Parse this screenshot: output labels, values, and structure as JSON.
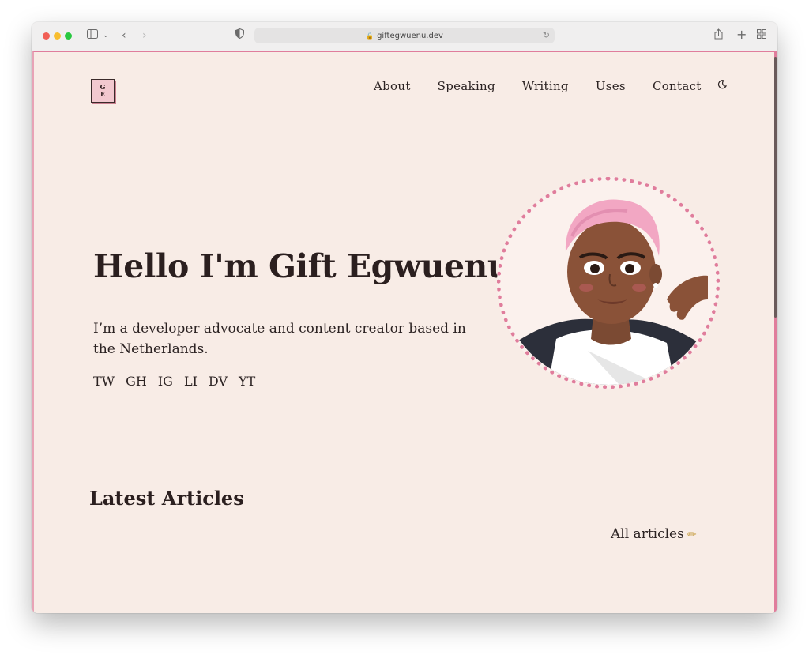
{
  "browser": {
    "url": "giftegwuenu.dev",
    "icons": {
      "sidebar": "sidebar-icon",
      "chevron": "chevron-down-icon",
      "back": "back-icon",
      "forward": "forward-icon",
      "shield": "shield-icon",
      "lock": "lock-icon",
      "reload": "reload-icon",
      "share": "share-icon",
      "new_tab": "plus-icon",
      "tabs": "tab-overview-icon"
    }
  },
  "site": {
    "logo": {
      "line1": "G",
      "line2": "E"
    },
    "nav": [
      {
        "label": "About"
      },
      {
        "label": "Speaking"
      },
      {
        "label": "Writing"
      },
      {
        "label": "Uses"
      },
      {
        "label": "Contact"
      }
    ],
    "theme_toggle_icon": "moon-icon",
    "accent_color": "#e07d9c",
    "background_color": "#f8ece6"
  },
  "hero": {
    "title": "Hello I'm Gift Egwuenu",
    "description": "I’m a developer advocate and content creator based in the Netherlands.",
    "socials": [
      "TW",
      "GH",
      "IG",
      "LI",
      "DV",
      "YT"
    ]
  },
  "articles": {
    "title": "Latest Articles",
    "all_link": "All articles",
    "all_link_icon": "pencil-icon"
  }
}
